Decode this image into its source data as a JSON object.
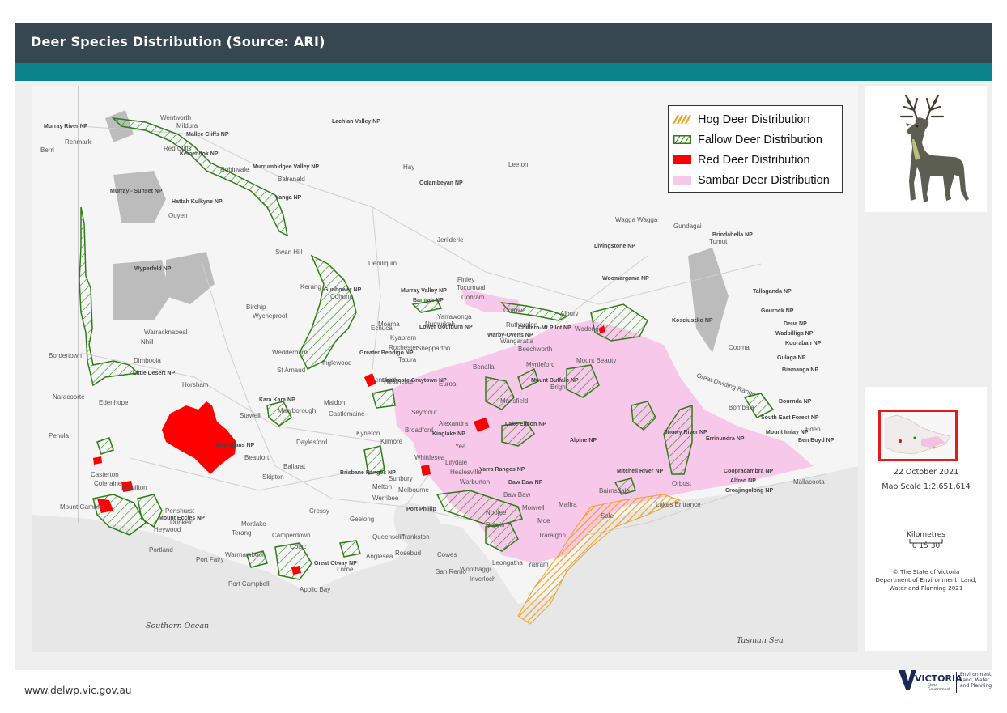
{
  "header": {
    "title": "Deer Species Distribution (Source: ARI)"
  },
  "legend": {
    "items": [
      {
        "label": "Hog Deer Distribution",
        "color": "#f2a21d",
        "pattern": "hatch"
      },
      {
        "label": "Fallow Deer Distribution",
        "color": "#2f7d16",
        "pattern": "hatch-outline"
      },
      {
        "label": "Red Deer Distribution",
        "color": "#ff0000",
        "pattern": "solid"
      },
      {
        "label": "Sambar Deer Distribution",
        "color": "#f7c8ea",
        "pattern": "solid"
      }
    ]
  },
  "map": {
    "places": [
      "Wentworth",
      "Mildura",
      "Red Cliffs",
      "Renmark",
      "Berri",
      "Robinvale",
      "Balranald",
      "Hay",
      "Ouyen",
      "Swan Hill",
      "Kerang",
      "Cohuna",
      "Birchip",
      "Wycheproof",
      "Warracknabeal",
      "Nhill",
      "Dimboola",
      "Bordertown",
      "Horsham",
      "Stawell",
      "Naracoorte",
      "Edenhope",
      "Penola",
      "Hamilton",
      "Mount Gambier",
      "Portland",
      "Heywood",
      "Warrnambool",
      "Port Fairy",
      "Port Campbell",
      "Colac",
      "Apollo Bay",
      "Lorne",
      "Anglesea",
      "Geelong",
      "Ballarat",
      "Daylesford",
      "Castlemaine",
      "Maldon",
      "Maryborough",
      "Bendigo",
      "Echuca",
      "Kyabram",
      "Shepparton",
      "Tatura",
      "Rochester",
      "Moama",
      "Numurkah",
      "Yarrawonga",
      "Cobram",
      "Tocumwal",
      "Finley",
      "Deniliquin",
      "Jerilderie",
      "Corowa",
      "Rutherglen",
      "Albury",
      "Wodonga",
      "Wangaratta",
      "Benalla",
      "Euroa",
      "Seymour",
      "Kilmore",
      "Kyneton",
      "Sunbury",
      "Melton",
      "Werribee",
      "Melbourne",
      "Frankston",
      "Cowes",
      "San Remo",
      "Wonthaggi",
      "Inverloch",
      "Leongatha",
      "Yarram",
      "Traralgon",
      "Sale",
      "Maffra",
      "Bairnsdale",
      "Lakes Entrance",
      "Orbost",
      "Mallacoota",
      "Eden",
      "Bombala",
      "Cooma",
      "Tumut",
      "Gundagai",
      "Wagga Wagga",
      "Leeton",
      "Beechworth",
      "Myrtleford",
      "Bright",
      "Mansfield",
      "Alexandra",
      "Yea",
      "Healesville",
      "Warburton",
      "Noojee",
      "Moe",
      "Morwell",
      "Drouin",
      "Queenscliff",
      "Rosebud",
      "Cressy",
      "Skipton",
      "Beaufort",
      "Mortlake",
      "Terang",
      "Camperdown",
      "Casterton",
      "Coleraine",
      "Penshurst",
      "Dunkeld",
      "St Arnaud",
      "Inglewood",
      "Wedderburn",
      "Heathcote",
      "Broadford",
      "Whittlesea",
      "Lilydale",
      "Baw Baw",
      "Mount Beauty"
    ],
    "parks": [
      "Murray River NP",
      "Mallee Cliffs NP",
      "Kemendok NP",
      "Hattah Kulkyne NP",
      "Murray - Sunset NP",
      "Wyperfeld NP",
      "Little Desert NP",
      "Murrumbidgee Valley NP",
      "Oolambeyan NP",
      "Lachlan Valley NP",
      "Gunbower NP",
      "Murray Valley NP",
      "Barmah NP",
      "Greater Bendigo NP",
      "Kara Kara NP",
      "Mount Eccles NP",
      "Great Otway NP",
      "Brisbane Ranges NP",
      "Heathcote Graytown NP",
      "Warby-Ovens NP",
      "Chiltern-Mt Pilot NP",
      "Woomargama NP",
      "Kosciuszko NP",
      "Livingstone NP",
      "Brindabella NP",
      "Tallaganda NP",
      "Gourock NP",
      "Deua NP",
      "Wadbilliga NP",
      "Kooraban NP",
      "Gulaga NP",
      "Biamanga NP",
      "Bournda NP",
      "South East Forest NP",
      "Mount Imlay NP",
      "Ben Boyd NP",
      "Alpine NP",
      "Mount Buffalo NP",
      "Kinglake NP",
      "Lake Eildon NP",
      "Yarra Ranges NP",
      "Baw Baw NP",
      "Snowy River NP",
      "Errinundra NP",
      "Coopracambra NP",
      "Alfred NP",
      "Croajingolong NP",
      "Mitchell River NP",
      "Grampians NP",
      "Lower Goulburn NP",
      "Yanga NP"
    ],
    "water_labels": [
      "Southern Ocean",
      "Tasman Sea",
      "Port Phillip"
    ],
    "range_label": "Great Dividing Range"
  },
  "side_panel": {
    "deer_icon": "stag-icon",
    "inset_map": "victoria-locator-map",
    "date": "22 October 2021",
    "map_scale": "Map Scale 1:2,651,614",
    "scalebar_title": "Kilometres",
    "scalebar_ticks": "0   15   30",
    "copyright": [
      "© The State of Victoria",
      "Department of Environment, Land,",
      "Water and Planning 2021"
    ]
  },
  "footer": {
    "url": "www.delwp.vic.gov.au",
    "logo_word": "VICTORIA",
    "logo_sub": [
      "State",
      "Government"
    ],
    "department": [
      "Environment,",
      "Land, Water",
      "and Planning"
    ]
  }
}
